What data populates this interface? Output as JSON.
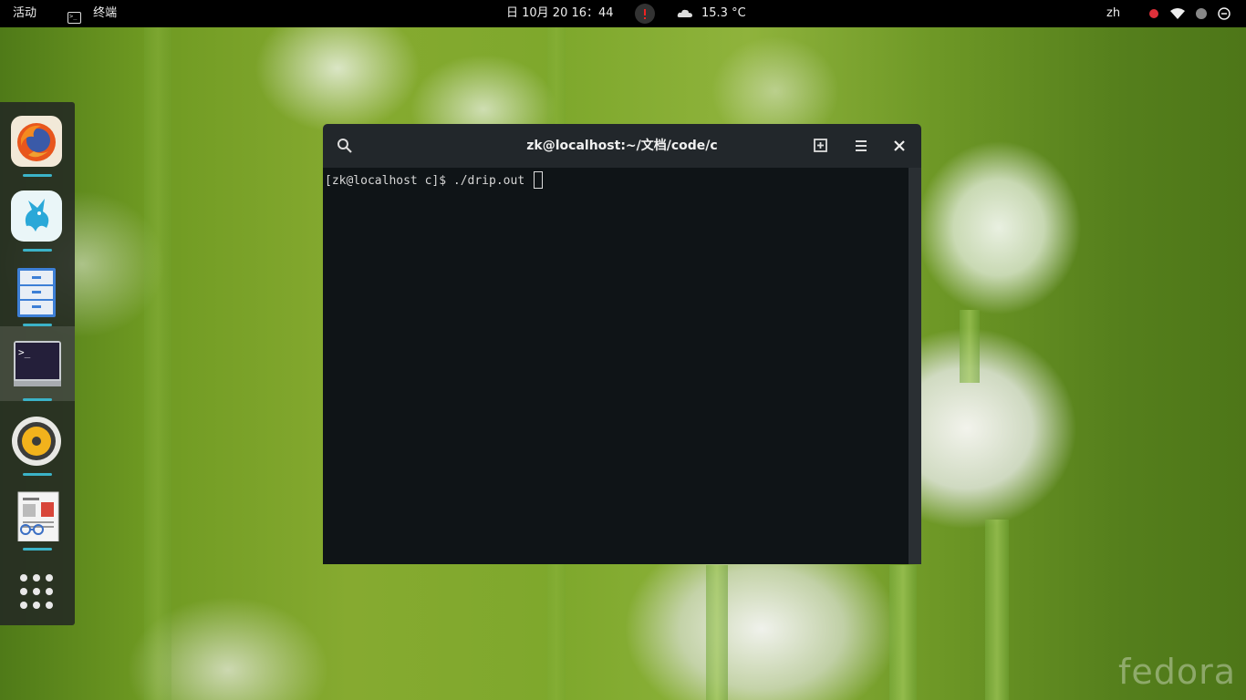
{
  "topbar": {
    "activities": "活动",
    "app_name": "终端",
    "datetime": "日 10月 20  16：44",
    "weather": "15.3 °C",
    "input_method": "zh"
  },
  "dock": {
    "items": [
      {
        "icon": "firefox-icon",
        "running": true
      },
      {
        "icon": "hedgewars-icon",
        "running": true
      },
      {
        "icon": "files-cabinet-icon",
        "running": true
      },
      {
        "icon": "terminal-icon",
        "running": true,
        "active": true
      },
      {
        "icon": "rhythmbox-icon",
        "running": true
      },
      {
        "icon": "document-viewer-icon",
        "running": true
      },
      {
        "icon": "show-applications-icon",
        "running": false
      }
    ]
  },
  "terminal": {
    "title": "zk@localhost:~/文档/code/c",
    "prompt_line": "[zk@localhost c]$ ./drip.out "
  },
  "wallpaper": {
    "watermark": "fedora"
  },
  "colors": {
    "dock_indicator": "#3bb3c8",
    "terminal_bg": "#0f1417",
    "header_bg": "#22272b"
  }
}
